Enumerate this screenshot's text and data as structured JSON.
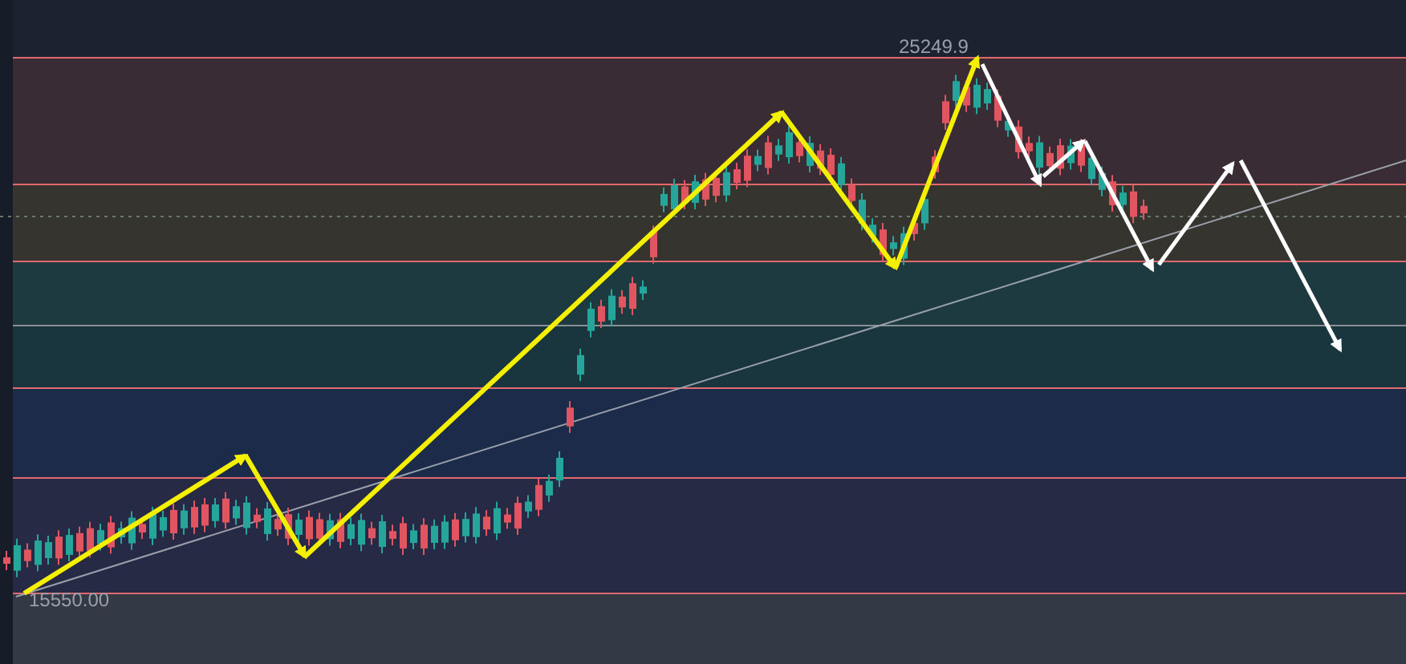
{
  "chart": {
    "high_label": "25249.9",
    "low_label": "15550.00"
  }
}
